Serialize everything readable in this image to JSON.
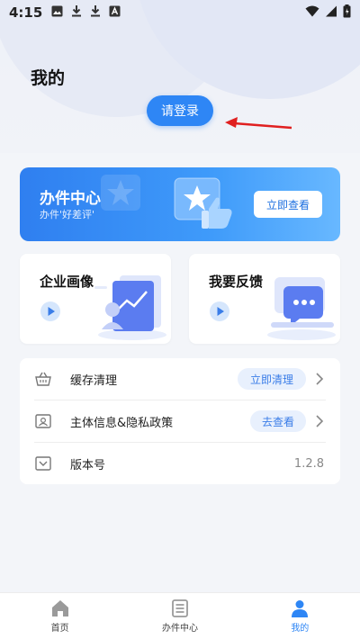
{
  "status_bar": {
    "time": "4:15"
  },
  "header": {
    "title": "我的",
    "login_label": "请登录"
  },
  "banner": {
    "title": "办件中心",
    "subtitle": "办件'好差评'",
    "button_label": "立即查看"
  },
  "cards": [
    {
      "title": "企业画像"
    },
    {
      "title": "我要反馈"
    }
  ],
  "settings": [
    {
      "label": "缓存清理",
      "action": "立即清理"
    },
    {
      "label": "主体信息&隐私政策",
      "action": "去查看"
    },
    {
      "label": "版本号",
      "value": "1.2.8"
    }
  ],
  "bottom_nav": [
    {
      "label": "首页",
      "icon": "home-icon",
      "active": false
    },
    {
      "label": "办件中心",
      "icon": "list-icon",
      "active": false
    },
    {
      "label": "我的",
      "icon": "user-icon",
      "active": true
    }
  ],
  "colors": {
    "accent": "#2e86f5",
    "annotation": "#e02020"
  }
}
